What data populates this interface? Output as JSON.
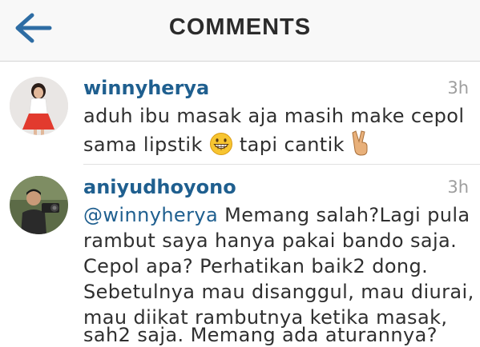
{
  "header": {
    "title": "COMMENTS",
    "back_icon": "arrow-left-icon",
    "accent": "#2e6da4"
  },
  "comments": [
    {
      "username": "winnyherya",
      "time": "3h",
      "lines": [
        {
          "text": "aduh ibu masak aja masih make cepol"
        },
        {
          "before": "sama lipstik",
          "emoji": "grinning-face-icon",
          "after": "tapi cantik",
          "emoji2": "victory-hand-icon"
        }
      ]
    },
    {
      "username": "aniyudhoyono",
      "time": "3h",
      "mention": "@winnyherya",
      "lines": [
        "Memang salah?Lagi pula",
        "rambut saya hanya pakai bando saja.",
        "Cepol apa? Perhatikan baik2 dong.",
        "Sebetulnya mau disanggul, mau diurai,",
        "mau diikat rambutnya ketika masak,",
        "sah2 saja. Memang ada aturannya?"
      ]
    }
  ],
  "colors": {
    "username": "#1f5f8f",
    "text": "#2f2f2f",
    "timestamp": "#9e9e9e"
  }
}
